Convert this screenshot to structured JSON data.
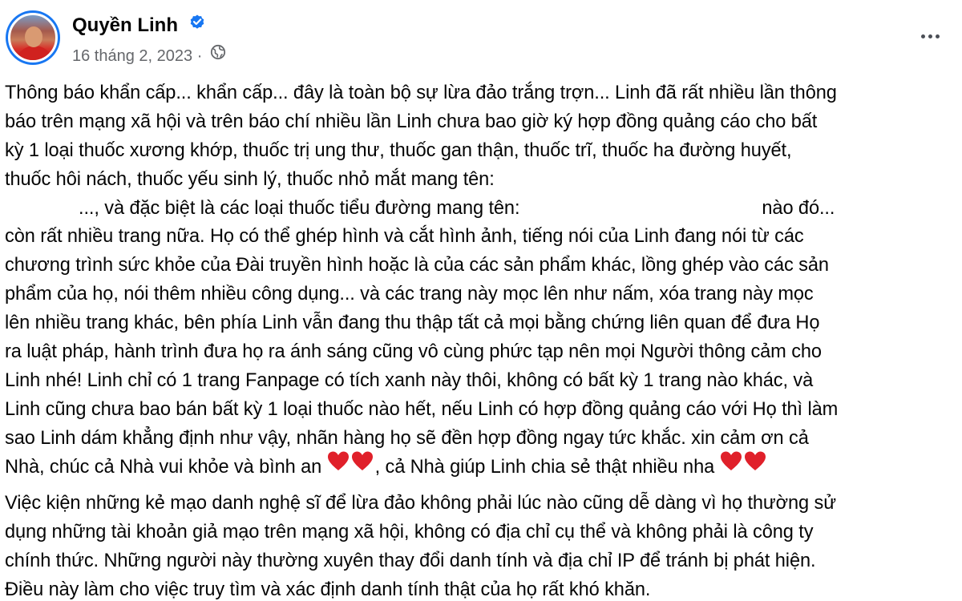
{
  "post": {
    "author_name": "Quyền Linh",
    "date": "16 tháng 2, 2023",
    "separator": "·",
    "privacy_icon": "globe-icon",
    "verified_icon": "verified-badge-icon",
    "more_icon": "more-options-icon",
    "accent_color": "#1877f2",
    "paragraph1_lines": [
      "Thông báo khẩn cấp... khẩn cấp... đây là toàn bộ sự lừa đảo trắng trợn... Linh đã rất nhiều lần thông",
      "báo trên mạng xã hội và trên báo chí nhiều lần Linh chưa bao giờ ký hợp đồng quảng cáo cho bất",
      "kỳ 1 loại thuốc xương khớp, thuốc trị ung thư, thuốc gan thận, thuốc trĩ, thuốc ha đường huyết,",
      "thuốc hôi nách, thuốc yếu sinh lý, thuốc nhỏ mắt mang tên:"
    ],
    "line5_part1": "..., và đặc biệt là các loại thuốc tiểu đường mang tên:",
    "line5_part2": "nào đó...",
    "paragraph1_rest": [
      "còn rất nhiều trang nữa. Họ có thể ghép hình và cắt hình ảnh, tiếng nói của Linh đang nói từ các",
      "chương trình sức khỏe của Đài truyền hình hoặc là của các sản phẩm khác, lồng ghép vào các sản",
      "phẩm của họ, nói thêm nhiều công dụng... và các trang này mọc lên như nấm, xóa trang này mọc",
      "lên nhiều trang khác, bên phía Linh vẫn đang thu thập tất cả mọi bằng chứng liên quan để đưa Họ",
      "ra luật pháp, hành trình đưa họ ra ánh sáng cũng vô cùng phức tạp nên mọi Người thông cảm cho",
      "Linh nhé! Linh chỉ có 1 trang Fanpage có tích xanh này thôi, không có bất kỳ 1 trang nào khác, và",
      "Linh cũng chưa bao bán bất kỳ 1 loại thuốc nào hết, nếu Linh có hợp đồng quảng cáo với Họ thì làm",
      "sao Linh dám khẳng định như vậy, nhãn hàng họ sẽ đền hợp đồng ngay tức khắc. xin cảm ơn cả"
    ],
    "last_line_part1": "Nhà, chúc cả Nhà vui khỏe và bình an",
    "last_line_part2": ", cả Nhà giúp Linh chia sẻ thật nhiều nha",
    "paragraph2_lines": [
      "Việc kiện những kẻ mạo danh nghệ sĩ để lừa đảo không phải lúc nào cũng dễ dàng vì họ thường sử",
      "dụng những tài khoản giả mạo trên mạng xã hội, không có địa chỉ cụ thể và không phải là công ty",
      "chính thức. Những người này thường xuyên thay đổi danh tính và địa chỉ IP để tránh bị phát hiện.",
      "Điều này làm cho việc truy tìm và xác định danh tính thật của họ rất khó khăn."
    ]
  }
}
